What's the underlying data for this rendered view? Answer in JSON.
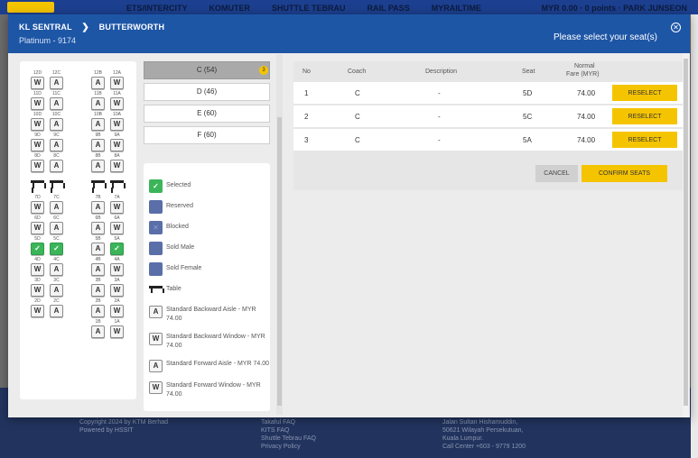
{
  "background": {
    "nav": [
      "ETS/INTERCITY",
      "KOMUTER",
      "SHUTTLE TEBRAU",
      "RAIL PASS",
      "MYRAILTIME"
    ],
    "account": "MYR 0.00 · 0 points · PARK JUNSEON",
    "footer": {
      "copyright": "Copyright 2024 by KTM Berhad",
      "powered": "Powered by HSSIT",
      "links": [
        "Takaful FAQ",
        "KITS FAQ",
        "Shuttle Tebrau FAQ",
        "Privacy Policy"
      ],
      "address": [
        "Jalan Sultan Hishamuddin,",
        "50621 Wilayah Persekutuan,",
        "Kuala Lumpur.",
        "Call Center +603 - 9779 1200"
      ]
    }
  },
  "header": {
    "origin": "KL SENTRAL",
    "destination": "BUTTERWORTH",
    "train": "Platinum - 9174",
    "prompt": "Please select your seat(s)",
    "close_icon": "close-circle-icon"
  },
  "coaches": [
    {
      "label": "C (54)",
      "active": true,
      "badge": "3"
    },
    {
      "label": "D (46)",
      "active": false
    },
    {
      "label": "E (60)",
      "active": false
    },
    {
      "label": "F (60)",
      "active": false
    }
  ],
  "seat_rows": [
    {
      "seats": [
        {
          "label": "12D",
          "type": "W"
        },
        {
          "label": "12C",
          "type": "A"
        },
        {
          "label": "12B",
          "type": "A"
        },
        {
          "label": "12A",
          "type": "W"
        }
      ]
    },
    {
      "seats": [
        {
          "label": "11D",
          "type": "W"
        },
        {
          "label": "11C",
          "type": "A"
        },
        {
          "label": "11B",
          "type": "A"
        },
        {
          "label": "11A",
          "type": "W"
        }
      ]
    },
    {
      "seats": [
        {
          "label": "10D",
          "type": "W"
        },
        {
          "label": "10C",
          "type": "A"
        },
        {
          "label": "10B",
          "type": "A"
        },
        {
          "label": "10A",
          "type": "W"
        }
      ]
    },
    {
      "seats": [
        {
          "label": "9D",
          "type": "W"
        },
        {
          "label": "9C",
          "type": "A"
        },
        {
          "label": "9B",
          "type": "A"
        },
        {
          "label": "9A",
          "type": "W"
        }
      ]
    },
    {
      "seats": [
        {
          "label": "8D",
          "type": "W"
        },
        {
          "label": "8C",
          "type": "A"
        },
        {
          "label": "8B",
          "type": "A"
        },
        {
          "label": "8A",
          "type": "W"
        }
      ]
    },
    {
      "seats": [
        {
          "label": "",
          "type": "table"
        },
        {
          "label": "",
          "type": "table"
        },
        {
          "label": "",
          "type": "table"
        },
        {
          "label": "",
          "type": "table"
        }
      ]
    },
    {
      "seats": [
        {
          "label": "7D",
          "type": "W"
        },
        {
          "label": "7C",
          "type": "A"
        },
        {
          "label": "7B",
          "type": "A"
        },
        {
          "label": "7A",
          "type": "W"
        }
      ]
    },
    {
      "seats": [
        {
          "label": "6D",
          "type": "W"
        },
        {
          "label": "6C",
          "type": "A"
        },
        {
          "label": "6B",
          "type": "A"
        },
        {
          "label": "6A",
          "type": "W"
        }
      ]
    },
    {
      "seats": [
        {
          "label": "5D",
          "type": "selected"
        },
        {
          "label": "5C",
          "type": "selected"
        },
        {
          "label": "5B",
          "type": "A"
        },
        {
          "label": "5A",
          "type": "selected"
        }
      ]
    },
    {
      "seats": [
        {
          "label": "4D",
          "type": "W"
        },
        {
          "label": "4C",
          "type": "A"
        },
        {
          "label": "4B",
          "type": "A"
        },
        {
          "label": "4A",
          "type": "W"
        }
      ]
    },
    {
      "seats": [
        {
          "label": "3D",
          "type": "W"
        },
        {
          "label": "3C",
          "type": "A"
        },
        {
          "label": "3B",
          "type": "A"
        },
        {
          "label": "3A",
          "type": "W"
        }
      ]
    },
    {
      "seats": [
        {
          "label": "2D",
          "type": "W"
        },
        {
          "label": "2C",
          "type": "A"
        },
        {
          "label": "2B",
          "type": "A"
        },
        {
          "label": "2A",
          "type": "W"
        }
      ]
    },
    {
      "seats": [
        null,
        null,
        {
          "label": "1B",
          "type": "A"
        },
        {
          "label": "1A",
          "type": "W"
        }
      ]
    }
  ],
  "legend": [
    {
      "icon": "check-icon",
      "kind": "green",
      "glyph": "✓",
      "text": "Selected"
    },
    {
      "icon": "reserved-icon",
      "kind": "blue",
      "glyph": "",
      "text": "Reserved"
    },
    {
      "icon": "blocked-icon",
      "kind": "blue",
      "glyph": "✕",
      "text": "Blocked"
    },
    {
      "icon": "sold-male-icon",
      "kind": "blue",
      "glyph": "",
      "text": "Sold Male"
    },
    {
      "icon": "sold-female-icon",
      "kind": "blue",
      "glyph": "",
      "text": "Sold Female"
    },
    {
      "icon": "table-icon",
      "kind": "tbl",
      "glyph": "",
      "text": "Table"
    },
    {
      "icon": "seat-a-icon",
      "kind": "seatic",
      "glyph": "A",
      "text": "Standard Backward Aisle - MYR 74.00"
    },
    {
      "icon": "seat-w-icon",
      "kind": "seatic",
      "glyph": "W",
      "text": "Standard Backward Window - MYR 74.00"
    },
    {
      "icon": "seat-a-icon",
      "kind": "seatic",
      "glyph": "A",
      "text": "Standard Forward Aisle - MYR 74.00"
    },
    {
      "icon": "seat-w-icon",
      "kind": "seatic",
      "glyph": "W",
      "text": "Standard Forward Window - MYR 74.00"
    }
  ],
  "table": {
    "headers": {
      "no": "No",
      "coach": "Coach",
      "description": "Description",
      "seat": "Seat",
      "fare_line1": "Normal",
      "fare_line2": "Fare (MYR)"
    },
    "rows": [
      {
        "no": "1",
        "coach": "C",
        "description": "-",
        "seat": "5D",
        "fare": "74.00",
        "action": "RESELECT"
      },
      {
        "no": "2",
        "coach": "C",
        "description": "-",
        "seat": "5C",
        "fare": "74.00",
        "action": "RESELECT"
      },
      {
        "no": "3",
        "coach": "C",
        "description": "-",
        "seat": "5A",
        "fare": "74.00",
        "action": "RESELECT"
      }
    ],
    "cancel": "CANCEL",
    "confirm": "CONFIRM SEATS"
  },
  "colors": {
    "brand_blue": "#1e56a6",
    "accent_yellow": "#f5c400",
    "selected_green": "#3cb55a"
  }
}
